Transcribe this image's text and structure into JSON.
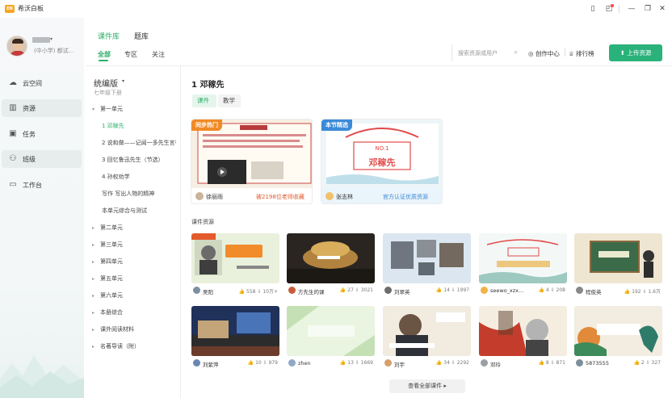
{
  "app": {
    "title": "希沃白板",
    "logo_text": "EN"
  },
  "window_controls": [
    {
      "name": "book-icon",
      "glyph": "▯"
    },
    {
      "name": "message-icon",
      "glyph": "◰"
    },
    {
      "name": "minimize-icon",
      "glyph": "—"
    },
    {
      "name": "restore-icon",
      "glyph": "❐"
    },
    {
      "name": "close-icon",
      "glyph": "✕"
    }
  ],
  "user": {
    "school": "(中小学) 都试..."
  },
  "nav": [
    {
      "label": "云空间",
      "icon": "cloud-icon",
      "glyph": "☁"
    },
    {
      "label": "资源",
      "icon": "library-icon",
      "glyph": "▥"
    },
    {
      "label": "任务",
      "icon": "task-icon",
      "glyph": "▣"
    },
    {
      "label": "班级",
      "icon": "class-icon",
      "glyph": "⚇"
    },
    {
      "label": "工作台",
      "icon": "workbench-icon",
      "glyph": "▭"
    }
  ],
  "top_tabs": [
    "课件库",
    "题库"
  ],
  "sub_tabs": [
    "全部",
    "专区",
    "关注"
  ],
  "search": {
    "placeholder": "搜索资源或用户"
  },
  "toolbar": {
    "creator_center": "创作中心",
    "ranking": "排行榜",
    "upload": "上传资源"
  },
  "tree": {
    "title": "统编版",
    "subtitle": "七年级下册",
    "rows": [
      {
        "label": "第一单元",
        "level": 0,
        "expanded": true
      },
      {
        "label": "1 邓稼先",
        "level": 1,
        "selected": true
      },
      {
        "label": "2 说和做——记闻一多先生言行片段",
        "level": 1
      },
      {
        "label": "3 回忆鲁迅先生（节选）",
        "level": 1
      },
      {
        "label": "4 孙权劝学",
        "level": 1
      },
      {
        "label": "写作 写出人物的精神",
        "level": 1
      },
      {
        "label": "本单元综合与测试",
        "level": 1
      },
      {
        "label": "第二单元",
        "level": 0
      },
      {
        "label": "第三单元",
        "level": 0
      },
      {
        "label": "第四单元",
        "level": 0
      },
      {
        "label": "第五单元",
        "level": 0
      },
      {
        "label": "第六单元",
        "level": 0
      },
      {
        "label": "本册综合",
        "level": 0
      },
      {
        "label": "课外阅读材料",
        "level": 0
      },
      {
        "label": "名著导读（附）",
        "level": 0
      }
    ]
  },
  "content": {
    "title": "1 邓稼先",
    "segments": [
      "课件",
      "教学"
    ],
    "featured": [
      {
        "badge": "同步热门",
        "badge_color": "#f08a24",
        "author": "徐丽雨",
        "note": "被2198位老师收藏",
        "note_color": "#e05a2b"
      },
      {
        "badge": "本节精选",
        "badge_color": "#3b8ad9",
        "author": "张志林",
        "note": "官方认证优质资源",
        "note_color": "#3b8ad9"
      }
    ],
    "section_label": "课件资源",
    "cards": [
      {
        "author": "吴阳",
        "stats": "👍 558  ⇩ 10万+",
        "theme": "portrait"
      },
      {
        "author": "方先生的课",
        "stats": "👍 27  ⇩ 3021",
        "theme": "dark"
      },
      {
        "author": "刘翠英",
        "stats": "👍 14  ⇩ 1997",
        "theme": "photos"
      },
      {
        "author": "seewo_xzx...",
        "stats": "👍 4  ⇩ 208",
        "theme": "title-light"
      },
      {
        "author": "程俊英",
        "stats": "👍 192  ⇩ 1.6万",
        "theme": "board"
      },
      {
        "author": "刘紫萍",
        "stats": "👍 10  ⇩ 979",
        "theme": "night"
      },
      {
        "author": "zhen",
        "stats": "👍 13  ⇩ 1669",
        "theme": "green"
      },
      {
        "author": "刘宇",
        "stats": "👍 34  ⇩ 2292",
        "theme": "reading"
      },
      {
        "author": "邓玲",
        "stats": "👍 8  ⇩ 871",
        "theme": "poster"
      },
      {
        "author": "5873555",
        "stats": "👍 2  ⇩ 327",
        "theme": "bird"
      }
    ],
    "more_label": "查看全部课件 ▸"
  }
}
